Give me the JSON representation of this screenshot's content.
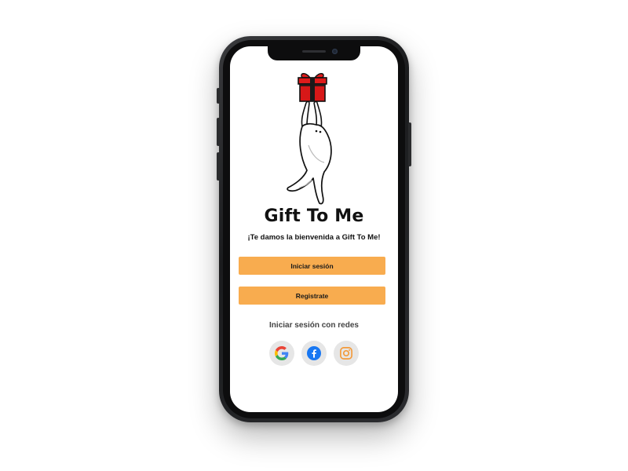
{
  "app": {
    "title": "Gift To Me",
    "welcome": "¡Te damos la bienvenida a Gift To Me!"
  },
  "buttons": {
    "login": "Iniciar sesión",
    "register": "Registrate"
  },
  "social": {
    "label": "Iniciar sesión con redes",
    "providers": [
      {
        "name": "google",
        "icon": "google-icon"
      },
      {
        "name": "facebook",
        "icon": "facebook-icon",
        "color": "#1877f2"
      },
      {
        "name": "instagram",
        "icon": "instagram-icon",
        "color": "#f39a3a"
      }
    ]
  },
  "colors": {
    "accent": "#f8ac4f",
    "gift": "#e01b1b",
    "social_bg": "#e6e6e6"
  }
}
